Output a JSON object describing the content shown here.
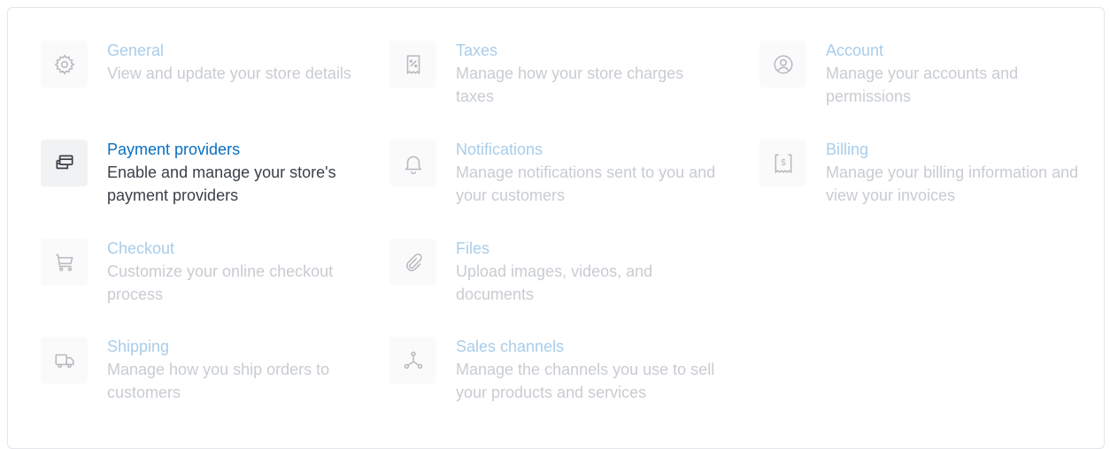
{
  "settings": {
    "items": [
      {
        "key": "general",
        "icon": "gear-icon",
        "title": "General",
        "description": "View and update your store details"
      },
      {
        "key": "taxes",
        "icon": "receipt-percent-icon",
        "title": "Taxes",
        "description": "Manage how your store charges taxes"
      },
      {
        "key": "account",
        "icon": "user-circle-icon",
        "title": "Account",
        "description": "Manage your accounts and permissions"
      },
      {
        "key": "payment-providers",
        "icon": "credit-cards-icon",
        "title": "Payment providers",
        "description": "Enable and manage your store's payment providers",
        "active": true
      },
      {
        "key": "notifications",
        "icon": "bell-icon",
        "title": "Notifications",
        "description": "Manage notifications sent to you and your customers"
      },
      {
        "key": "billing",
        "icon": "billing-receipt-icon",
        "title": "Billing",
        "description": "Manage your billing information and view your invoices"
      },
      {
        "key": "checkout",
        "icon": "shopping-cart-icon",
        "title": "Checkout",
        "description": "Customize your online checkout process"
      },
      {
        "key": "files",
        "icon": "paperclip-icon",
        "title": "Files",
        "description": "Upload images, videos, and documents"
      },
      {
        "key": "shipping",
        "icon": "truck-icon",
        "title": "Shipping",
        "description": "Manage how you ship orders to customers"
      },
      {
        "key": "sales-channels",
        "icon": "channels-icon",
        "title": "Sales channels",
        "description": "Manage the channels you use to sell your products and services"
      }
    ]
  },
  "colors": {
    "accent": "#0a6fc2",
    "muted_title": "#a9cdea",
    "muted_text": "#c8ccd1",
    "active_text": "#3a4149"
  }
}
